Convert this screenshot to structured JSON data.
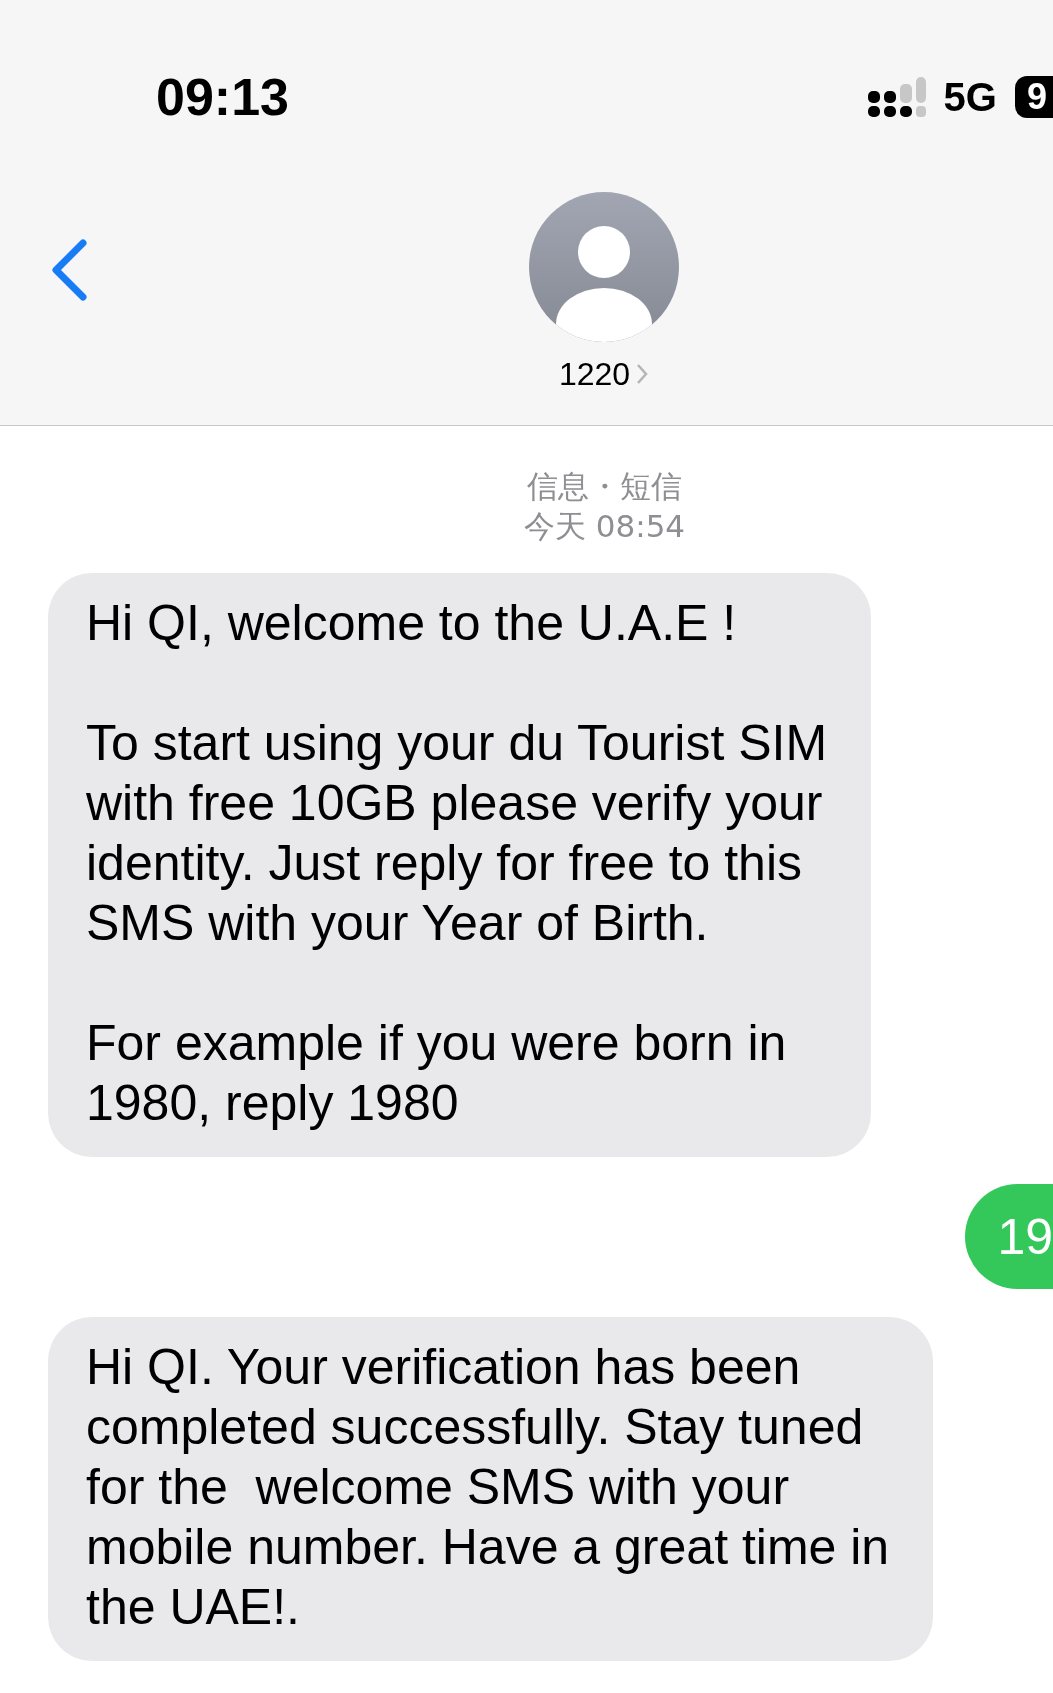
{
  "status_bar": {
    "time": "09:13",
    "network": "5G",
    "battery": "9"
  },
  "header": {
    "contact": "1220"
  },
  "meta": {
    "service": "信息・短信",
    "timestamp": "今天 08:54"
  },
  "messages": [
    {
      "kind": "received",
      "paragraphs": [
        "Hi QI, welcome to the U.A.E !",
        "To start using your du Tourist SIM\nwith free 10GB please verify your\nidentity. Just reply for free to this\nSMS with your Year of Birth.",
        "For example if you were born in\n1980, reply 1980"
      ]
    },
    {
      "kind": "sent",
      "paragraphs": [
        "19"
      ]
    },
    {
      "kind": "received",
      "paragraphs": [
        "Hi QI. Your verification has been\ncompleted successfully. Stay tuned\nfor the  welcome SMS with your\nmobile number. Have a great time in\nthe UAE!."
      ]
    }
  ]
}
